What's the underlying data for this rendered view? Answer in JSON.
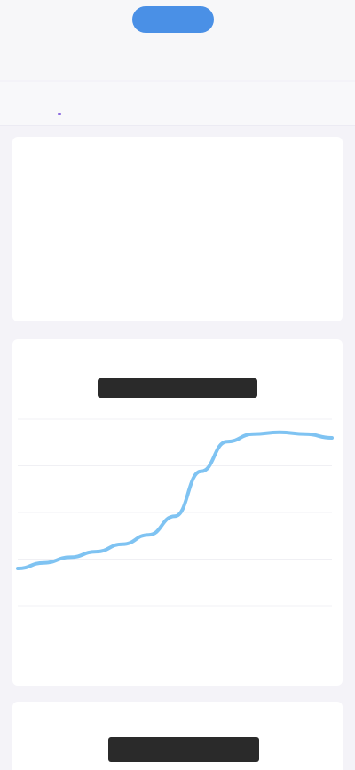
{
  "topbar": {
    "left_label": "",
    "pill_label": "",
    "right_label": ""
  },
  "header": {
    "back_label": "",
    "title": ""
  },
  "tabs": [
    {
      "label": ""
    },
    {
      "label": ""
    },
    {
      "label": ""
    }
  ],
  "summary_card": {
    "label": "",
    "link": "",
    "metrics": [
      {
        "label": "",
        "value": "",
        "tone": "green"
      },
      {
        "label": "",
        "value": "",
        "tone": "gray"
      },
      {
        "label": "",
        "value": "",
        "tone": "red"
      },
      {
        "label": "",
        "value": "",
        "tone": "green"
      },
      {
        "label": "",
        "value": "",
        "tone": "red"
      }
    ]
  },
  "chart_section": {
    "label": "",
    "chart_title": ""
  },
  "chart_data": {
    "type": "line",
    "title": "",
    "xlabel": "",
    "ylabel": "",
    "x": [
      0,
      1,
      2,
      3,
      4,
      5,
      6,
      7,
      8,
      9,
      10,
      11,
      12
    ],
    "series": [
      {
        "values": [
          20,
          23,
          26,
          29,
          33,
          38,
          48,
          72,
          88,
          92,
          93,
          92,
          90
        ]
      }
    ],
    "ylim": [
      0,
      100
    ],
    "grid": true,
    "colors": {
      "line": "#7fc3f2"
    }
  },
  "bottom_section": {
    "label": "",
    "dark_label": ""
  }
}
